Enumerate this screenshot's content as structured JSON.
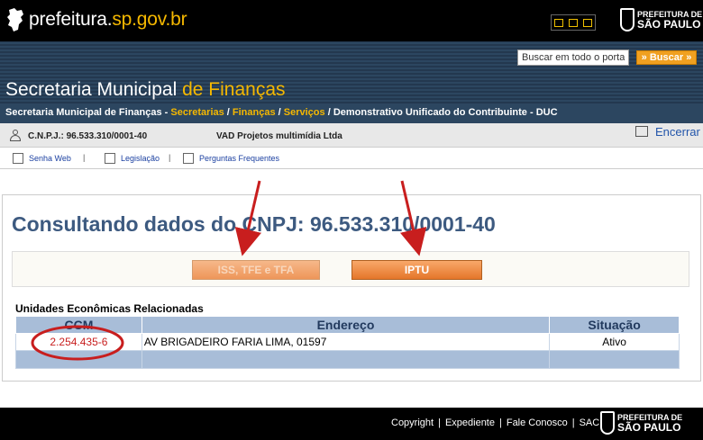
{
  "header": {
    "portal_prefix": "prefeitura.",
    "portal_domain": "sp.gov.br",
    "pref_line1": "PREFEITURA DE",
    "pref_line2": "SÃO PAULO"
  },
  "search": {
    "placeholder": "Buscar em todo o portal",
    "button": "» Buscar »"
  },
  "section_title": {
    "part1": "Secretaria Municipal ",
    "part2": "de Finanças"
  },
  "breadcrumb": {
    "item1": "Secretaria Municipal de Finanças - ",
    "item2": "Secretarias",
    "sep1": " / ",
    "item3": "Finanças",
    "sep2": " / ",
    "item4": "Serviços",
    "sep3": " / ",
    "item5": "Demonstrativo Unificado do Contribuinte - DUC"
  },
  "user": {
    "cnpj_label": "C.N.P.J.: 96.533.310/0001-40",
    "company": "VAD Projetos multimídia Ltda",
    "exit": "Encerrar"
  },
  "links": {
    "senha": "Senha Web",
    "legislacao": "Legislação",
    "perguntas": "Perguntas Frequentes",
    "sep": "|"
  },
  "main": {
    "heading": "Consultando dados do CNPJ: 96.533.310/0001-40",
    "btn_iss": "ISS, TFE e TFA",
    "btn_iptu": "IPTU",
    "units_label": "Unidades Econômicas Relacionadas"
  },
  "table": {
    "headers": [
      "CCM",
      "Endereço",
      "Situação"
    ],
    "rows": [
      {
        "ccm": "2.254.435-6",
        "endereco": "AV BRIGADEIRO FARIA LIMA, 01597",
        "situacao": "Ativo"
      }
    ]
  },
  "footer": {
    "links": [
      "Copyright",
      "Expediente",
      "Fale Conosco",
      "SAC"
    ],
    "sep": "|",
    "pref_line1": "PREFEITURA DE",
    "pref_line2": "SÃO PAULO"
  },
  "colors": {
    "accent": "#f5b800",
    "header_blue": "#2c4660",
    "button_orange": "#e5762a",
    "annotation_red": "#c81e1e"
  }
}
